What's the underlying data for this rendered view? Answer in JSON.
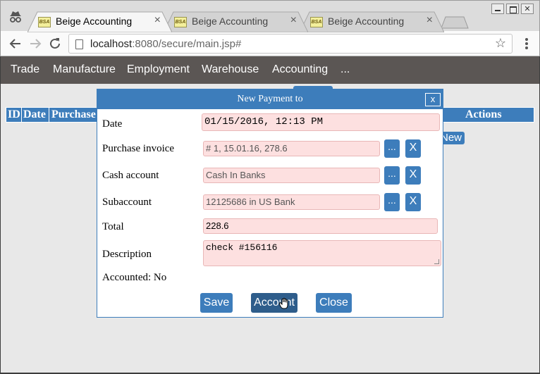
{
  "browser": {
    "tabs": [
      {
        "favicon": "BSA",
        "title": "Beige Accounting",
        "close": "×",
        "active": true
      },
      {
        "favicon": "BSA",
        "title": "Beige Accounting",
        "close": "×",
        "active": false
      },
      {
        "favicon": "BSA",
        "title": "Beige Accounting",
        "close": "×",
        "active": false
      }
    ],
    "url_host": "localhost",
    "url_rest": ":8080/secure/main.jsp#",
    "star": "☆"
  },
  "menu": [
    "Trade",
    "Manufacture",
    "Employment",
    "Warehouse",
    "Accounting",
    "..."
  ],
  "background_table": {
    "headers": [
      "ID",
      "Date",
      "Purchase",
      "Actions"
    ],
    "new_button": "New"
  },
  "dialog": {
    "title": "New Payment to",
    "close_label": "x",
    "fields": {
      "date": {
        "label": "Date",
        "value": "01/15/2016, 12:13 PM"
      },
      "purchase_invoice": {
        "label": "Purchase invoice",
        "value": "# 1, 15.01.16, 278.6"
      },
      "cash_account": {
        "label": "Cash account",
        "value": "Cash In Banks"
      },
      "subaccount": {
        "label": "Subaccount",
        "value": "12125686 in US Bank"
      },
      "total": {
        "label": "Total",
        "value": "228.6"
      },
      "description": {
        "label": "Description",
        "value": "check #156116"
      }
    },
    "pick_label": "...",
    "clear_label": "X",
    "accounted": "Accounted: No",
    "buttons": {
      "save": "Save",
      "account": "Account",
      "close": "Close"
    }
  },
  "colors": {
    "accent": "#3d7dbb",
    "field_bg": "#fde0e0",
    "menubar": "#5b5654"
  }
}
